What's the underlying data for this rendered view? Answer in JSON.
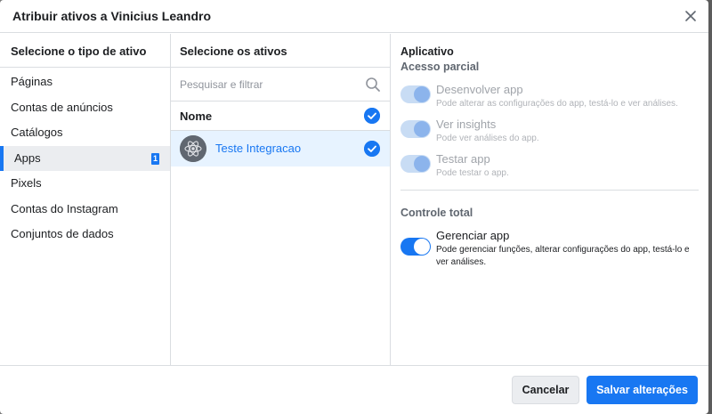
{
  "dialog": {
    "title": "Atribuir ativos a Vinicius Leandro"
  },
  "asset_types": {
    "header": "Selecione o tipo de ativo",
    "items": [
      {
        "label": "Páginas"
      },
      {
        "label": "Contas de anúncios"
      },
      {
        "label": "Catálogos"
      },
      {
        "label": "Apps",
        "count": "1",
        "selected": true
      },
      {
        "label": "Pixels"
      },
      {
        "label": "Contas do Instagram"
      },
      {
        "label": "Conjuntos de dados"
      }
    ]
  },
  "assets": {
    "header": "Selecione os ativos",
    "search_placeholder": "Pesquisar e filtrar",
    "name_column": "Nome",
    "items": [
      {
        "label": "Teste Integracao",
        "checked": true
      }
    ]
  },
  "permissions": {
    "title": "Aplicativo",
    "partial": {
      "title": "Acesso parcial",
      "items": [
        {
          "label": "Desenvolver app",
          "desc": "Pode alterar as configurações do app, testá-lo e ver análises."
        },
        {
          "label": "Ver insights",
          "desc": "Pode ver análises do app."
        },
        {
          "label": "Testar app",
          "desc": "Pode testar o app."
        }
      ]
    },
    "full": {
      "title": "Controle total",
      "items": [
        {
          "label": "Gerenciar app",
          "desc": "Pode gerenciar funções, alterar configurações do app, testá-lo e ver análises.",
          "on": true
        }
      ]
    }
  },
  "footer": {
    "cancel_label": "Cancelar",
    "save_label": "Salvar alterações"
  },
  "colors": {
    "accent": "#1877f2",
    "selected_bg": "#e7f3ff"
  }
}
